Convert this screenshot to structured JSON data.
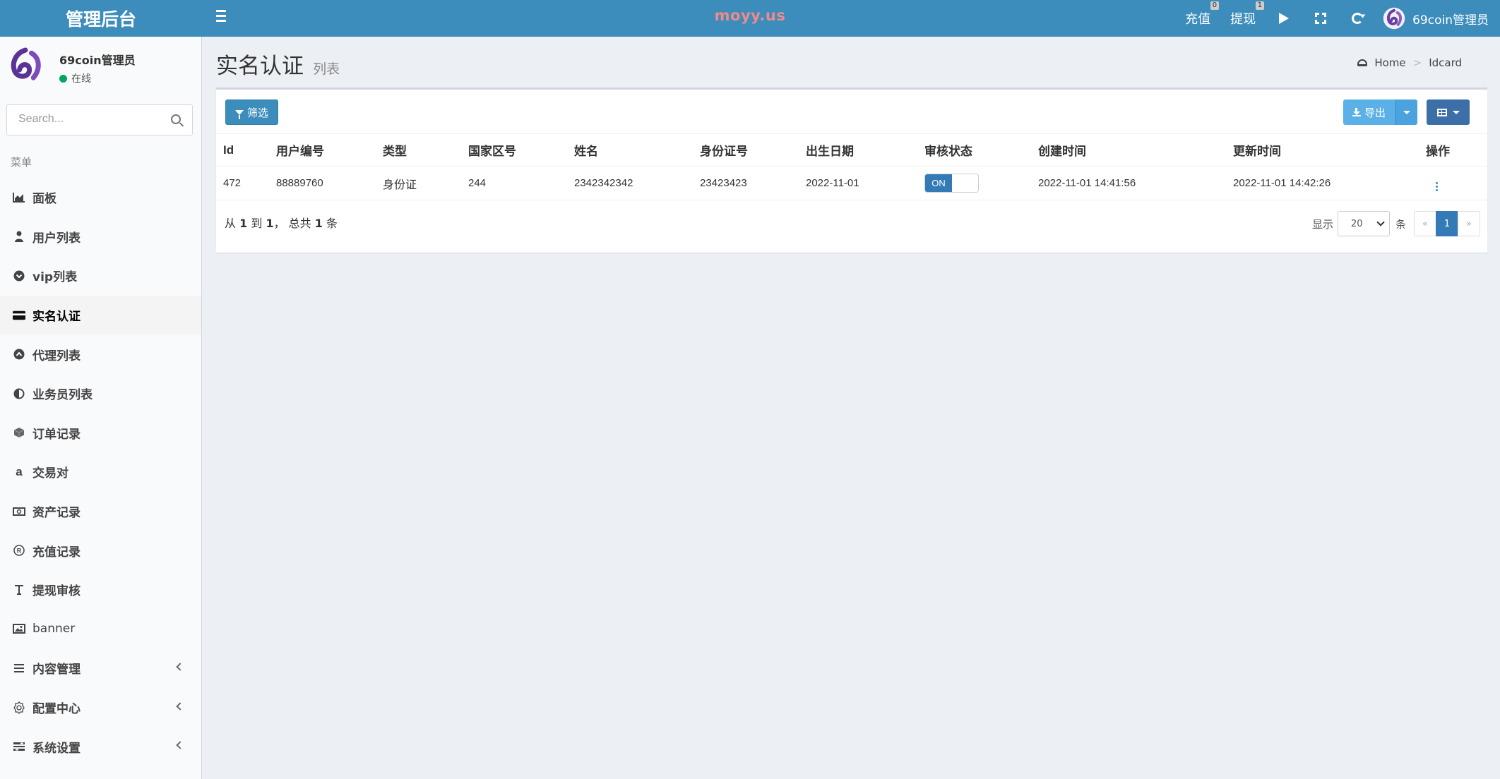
{
  "header": {
    "logo": "管理后台",
    "site_title": "moyy.us",
    "recharge_label": "充值",
    "recharge_badge": "0",
    "withdraw_label": "提现",
    "withdraw_badge": "1",
    "user_name": "69coin管理员",
    "icons": [
      "menu-icon",
      "play-icon",
      "fullscreen-icon",
      "refresh-icon"
    ]
  },
  "sidebar": {
    "user_name": "69coin管理员",
    "status": "在线",
    "search_placeholder": "Search...",
    "menu_header": "菜单",
    "items": [
      {
        "label": "面板",
        "icon": "area-chart-icon"
      },
      {
        "label": "用户列表",
        "icon": "user-icon"
      },
      {
        "label": "vip列表",
        "icon": "chevron-circle-icon"
      },
      {
        "label": "实名认证",
        "icon": "credit-card-icon",
        "active": true
      },
      {
        "label": "代理列表",
        "icon": "arrow-circle-icon"
      },
      {
        "label": "业务员列表",
        "icon": "adjust-icon"
      },
      {
        "label": "订单记录",
        "icon": "cube-icon"
      },
      {
        "label": "交易对",
        "icon": "amazon-icon"
      },
      {
        "label": "资产记录",
        "icon": "money-icon"
      },
      {
        "label": "充值记录",
        "icon": "registered-icon"
      },
      {
        "label": "提现审核",
        "icon": "text-icon"
      },
      {
        "label": "banner",
        "icon": "image-icon"
      },
      {
        "label": "内容管理",
        "icon": "list-icon",
        "has_children": true
      },
      {
        "label": "配置中心",
        "icon": "gear-outline-icon",
        "has_children": true
      },
      {
        "label": "系统设置",
        "icon": "settings-list-icon",
        "has_children": true
      }
    ]
  },
  "content": {
    "title": "实名认证",
    "subtitle": "列表",
    "breadcrumb": [
      "Home",
      "Idcard"
    ],
    "toolbar": {
      "filter_label": "筛选",
      "export_label": "导出"
    },
    "table": {
      "columns": [
        "Id",
        "用户编号",
        "类型",
        "国家区号",
        "姓名",
        "身份证号",
        "出生日期",
        "审核状态",
        "创建时间",
        "更新时间",
        "操作"
      ],
      "rows": [
        {
          "id": "472",
          "user_no": "88889760",
          "type": "身份证",
          "country_code": "244",
          "name": "2342342342",
          "id_number": "23423423",
          "birth_date": "2022-11-01",
          "status": "ON",
          "created_at": "2022-11-01 14:41:56",
          "updated_at": "2022-11-01 14:42:26"
        }
      ]
    },
    "summary": {
      "prefix": "从",
      "from": "1",
      "to_label": "到",
      "to": "1",
      "total_label": "，  总共",
      "total": "1",
      "suffix": "条"
    },
    "pagination": {
      "show_label": "显示",
      "page_size": "20",
      "unit_label": "条",
      "prev": "«",
      "current": "1",
      "next": "»"
    }
  },
  "colors": {
    "header_bg": "#3c8dbc",
    "site_title": "#f08a8a",
    "primary": "#3c8dbc",
    "switch_on": "#337ab7"
  }
}
